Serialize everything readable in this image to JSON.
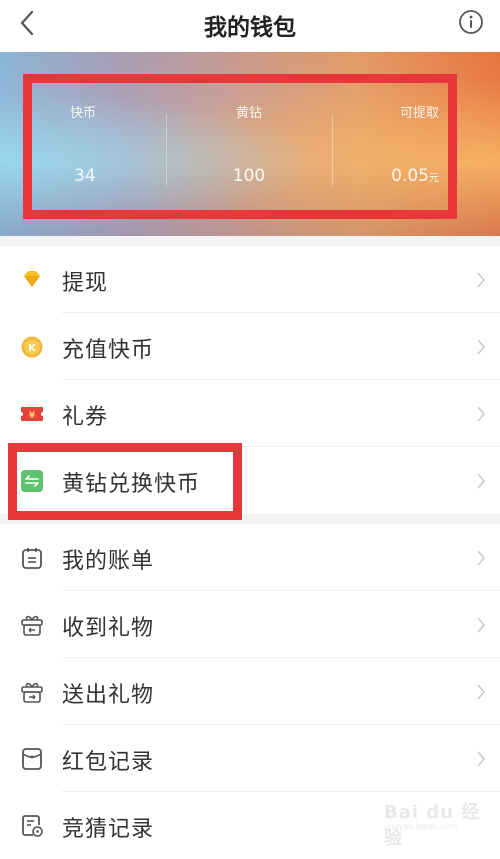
{
  "header": {
    "title": "我的钱包",
    "back_icon": "chevron-left-icon",
    "info_icon": "info-circle-icon"
  },
  "balances": [
    {
      "label": "快币",
      "value": "34",
      "unit": ""
    },
    {
      "label": "黄钻",
      "value": "100",
      "unit": ""
    },
    {
      "label": "可提取",
      "value": "0.05",
      "unit": "元"
    }
  ],
  "menu_group_1": [
    {
      "label": "提现",
      "icon": "diamond-icon",
      "icon_color": "#f5c224"
    },
    {
      "label": "充值快币",
      "icon": "kuaibi-coin-icon",
      "icon_color": "#f0b63a"
    },
    {
      "label": "礼券",
      "icon": "coupon-ticket-icon",
      "icon_color": "#e2453a"
    },
    {
      "label": "黄钻兑换快币",
      "icon": "exchange-icon",
      "icon_color": "#5cc26e"
    }
  ],
  "menu_group_2": [
    {
      "label": "我的账单",
      "icon": "bill-calendar-icon"
    },
    {
      "label": "收到礼物",
      "icon": "gift-received-icon"
    },
    {
      "label": "送出礼物",
      "icon": "gift-sent-icon"
    },
    {
      "label": "红包记录",
      "icon": "red-envelope-icon"
    },
    {
      "label": "竞猜记录",
      "icon": "quiz-record-icon"
    }
  ],
  "watermark": {
    "main": "Bai du 经验",
    "sub": "jingyan.baidu.com"
  },
  "colors": {
    "highlight_border": "#e8373a",
    "chevron": "#c8c8c8",
    "icon_gray": "#555555"
  }
}
